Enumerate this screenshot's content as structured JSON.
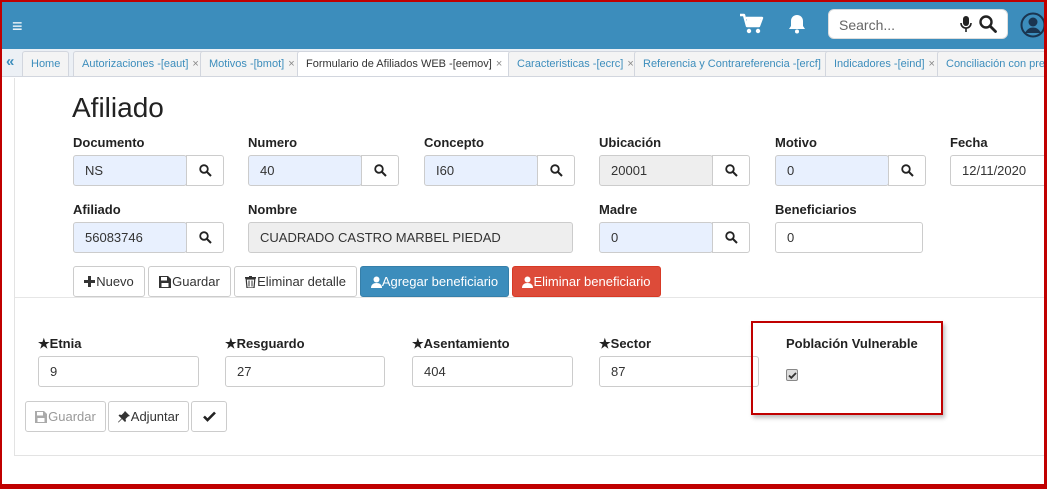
{
  "navbar": {
    "menu_icon": "hamburger-icon",
    "cart_icon": "cart-icon",
    "bell_icon": "bell-icon",
    "search_placeholder": "Search...",
    "mic_icon": "mic-icon",
    "search_icon": "search-icon",
    "user_icon": "user-circle-icon",
    "color": "#3c8dbc"
  },
  "tabs": {
    "scroll_left": "«",
    "close": "×",
    "items": [
      {
        "label": "Home"
      },
      {
        "label": "Autorizaciones -[eaut]"
      },
      {
        "label": "Motivos -[bmot]"
      },
      {
        "label": "Formulario de Afiliados WEB -[eemov]"
      },
      {
        "label": "Caracteristicas -[ecrc]"
      },
      {
        "label": "Referencia y Contrareferencia -[ercf]"
      },
      {
        "label": "Indicadores -[eind]"
      },
      {
        "label": "Conciliación con prest"
      }
    ]
  },
  "form": {
    "title": "Afiliado",
    "fields": {
      "documento": {
        "label": "Documento",
        "value": "NS"
      },
      "numero": {
        "label": "Numero",
        "value": "40"
      },
      "concepto": {
        "label": "Concepto",
        "value": "I60"
      },
      "ubicacion": {
        "label": "Ubicación",
        "value": "20001"
      },
      "motivo": {
        "label": "Motivo",
        "value": "0"
      },
      "fecha": {
        "label": "Fecha",
        "value": "12/11/2020"
      },
      "afiliado": {
        "label": "Afiliado",
        "value": "56083746"
      },
      "nombre": {
        "label": "Nombre",
        "value": "CUADRADO CASTRO MARBEL PIEDAD"
      },
      "madre": {
        "label": "Madre",
        "value": "0"
      },
      "beneficiarios": {
        "label": "Beneficiarios",
        "value": "0"
      }
    },
    "buttons": {
      "nuevo": "Nuevo",
      "guardar": "Guardar",
      "eliminar_detalle": "Eliminar detalle",
      "agregar_beneficiario": "Agregar beneficiario",
      "eliminar_beneficiario": "Eliminar beneficiario"
    }
  },
  "detail": {
    "etnia": {
      "label": "Etnia",
      "value": "9"
    },
    "resguardo": {
      "label": "Resguardo",
      "value": "27"
    },
    "asentamiento": {
      "label": "Asentamiento",
      "value": "404"
    },
    "sector": {
      "label": "Sector",
      "value": "87"
    },
    "poblacion": {
      "label": "Población Vulnerable",
      "checked": true
    },
    "buttons": {
      "guardar": "Guardar",
      "adjuntar": "Adjuntar"
    },
    "highlight_color": "#c00000"
  }
}
